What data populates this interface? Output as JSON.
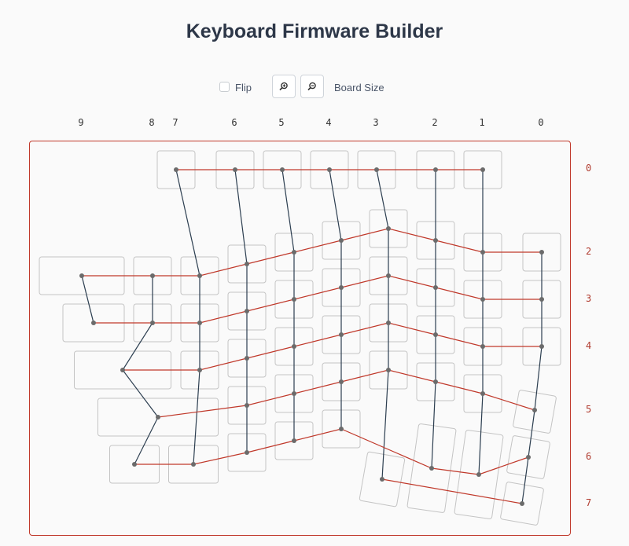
{
  "header": {
    "title": "Keyboard Firmware Builder"
  },
  "toolbar": {
    "board_size_label": "Board Size",
    "flip_label": "Flip",
    "flip_checked": false
  },
  "matrix": {
    "col_labels": [
      "0",
      "1",
      "2",
      "3",
      "4",
      "5",
      "6",
      "7",
      "8",
      "9"
    ],
    "row_labels": [
      "0",
      "2",
      "3",
      "4",
      "5",
      "6",
      "7"
    ]
  },
  "colors": {
    "row_wire": "#c0392b",
    "col_wire": "#2c3e50",
    "key_border": "#c4c4c4",
    "frame": "#c0392b",
    "title": "#2d3748"
  }
}
